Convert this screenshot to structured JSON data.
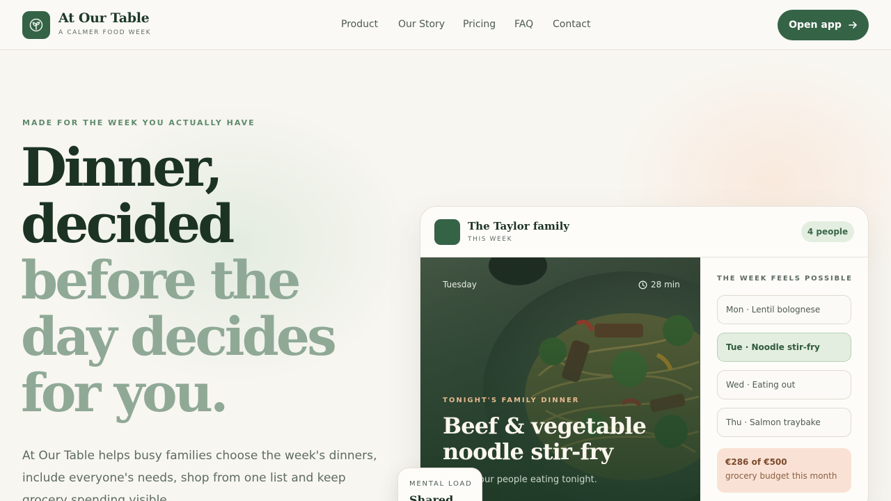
{
  "brand": {
    "name": "At Our Table",
    "tagline": "A CALMER FOOD WEEK"
  },
  "nav": {
    "items": [
      "Product",
      "Our Story",
      "Pricing",
      "FAQ",
      "Contact"
    ]
  },
  "header": {
    "cta_label": "Open app"
  },
  "hero": {
    "eyebrow": "MADE FOR THE WEEK YOU ACTUALLY HAVE",
    "headline_dark": [
      "Dinner,",
      "decided"
    ],
    "headline_light": [
      "before the",
      "day decides",
      "for you."
    ],
    "body": "At Our Table helps busy families choose the week's dinners, include everyone's needs, shop from one list and keep grocery spending visible."
  },
  "card": {
    "family": "The Taylor family",
    "subtitle": "THIS WEEK",
    "people_badge": "4 people",
    "meal": {
      "day": "Tuesday",
      "time": "28 min",
      "eyebrow": "TONIGHT'S FAMILY DINNER",
      "title": "Beef & vegetable noodle stir-fry",
      "subtitle": "for the four people eating tonight."
    },
    "week_title": "THE WEEK FEELS POSSIBLE",
    "days": [
      {
        "label": "Mon · Lentil bolognese"
      },
      {
        "label": "Tue · Noodle stir-fry"
      },
      {
        "label": "Wed · Eating out"
      },
      {
        "label": "Thu · Salmon traybake"
      }
    ],
    "budget": {
      "amount": "€286 of €500",
      "label": "grocery budget this month"
    }
  },
  "mental_load": {
    "label": "MENTAL LOAD",
    "value": "Shared"
  },
  "colors": {
    "brand_green": "#356346",
    "background": "#f8f6f1",
    "headline_light": "#8fa996",
    "budget_bg": "#f9e2d5"
  },
  "icons": {
    "logo": "leaf-sprout-icon",
    "cta_arrow": "arrow-right-icon",
    "time": "clock-icon"
  }
}
